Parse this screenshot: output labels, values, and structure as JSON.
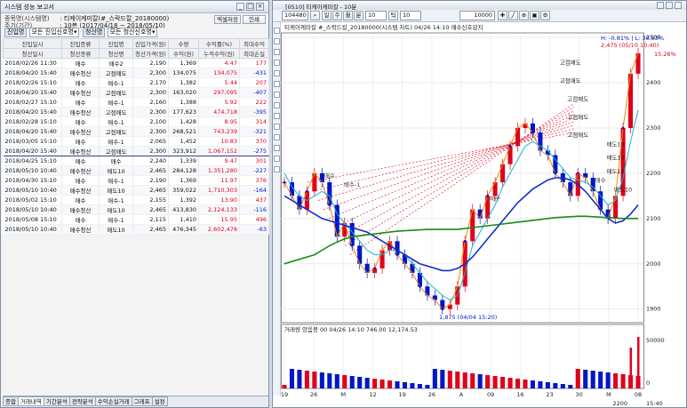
{
  "report": {
    "title": "시스템 성능 보고서",
    "strategy_label": "종목명(시스템명)",
    "strategy_value": ": 티케이케미칼(#_스락드칼_20180000)",
    "period_label": "주기(기간)",
    "period_value": ": 10분 (2017/04/18 ~ 2018/05/10)",
    "buttons": [
      "엑셀저장",
      "인쇄"
    ],
    "filter1_label": "진입명",
    "filter1_value": "모든 진입신호명",
    "filter2_label": "청산명",
    "filter2_value": "모든 청산신호명",
    "headers_top": [
      "진입일시",
      "진입종류",
      "진입명",
      "진입가격(원)",
      "수량",
      "수익률(%)",
      "최대수익"
    ],
    "headers_bottom": [
      "청산일시",
      "청산종류",
      "청산명",
      "청산가격(원)",
      "수익(원)",
      "누적수익(원)",
      "최대손실"
    ],
    "rows": [
      {
        "date": "2018/02/26 11:30",
        "kind": "매수",
        "name": "매수2",
        "price": "2,190",
        "qty": "1,369",
        "pct": "4.47",
        "max": "177",
        "pct_dir": "red",
        "max_dir": "red"
      },
      {
        "date": "2018/04/20 15:40",
        "kind": "매수청산",
        "name": "고점매도",
        "price": "2,300",
        "qty": "134,075",
        "pct": "134,075",
        "max": "-431",
        "pct_dir": "red",
        "max_dir": "blue"
      },
      {
        "date": "2018/02/26 15:10",
        "kind": "매수",
        "name": "매수-1",
        "price": "2,170",
        "qty": "1,382",
        "pct": "5.44",
        "max": "207",
        "pct_dir": "red",
        "max_dir": "red"
      },
      {
        "date": "2018/04/20 15:40",
        "kind": "매수청산",
        "name": "고점매도",
        "price": "2,300",
        "qty": "163,020",
        "pct": "297,095",
        "max": "-407",
        "pct_dir": "red",
        "max_dir": "blue"
      },
      {
        "date": "2018/02/27 15:10",
        "kind": "매수",
        "name": "매수-1",
        "price": "2,160",
        "qty": "1,388",
        "pct": "5.92",
        "max": "222",
        "pct_dir": "red",
        "max_dir": "red"
      },
      {
        "date": "2018/04/20 15:40",
        "kind": "매수청산",
        "name": "고점매도",
        "price": "2,300",
        "qty": "177,623",
        "pct": "474,718",
        "max": "-395",
        "pct_dir": "red",
        "max_dir": "blue"
      },
      {
        "date": "2018/02/28 15:10",
        "kind": "매수",
        "name": "매수-1",
        "price": "2,100",
        "qty": "1,428",
        "pct": "8.95",
        "max": "314",
        "pct_dir": "red",
        "max_dir": "red"
      },
      {
        "date": "2018/04/20 15:40",
        "kind": "매수청산",
        "name": "고점매도",
        "price": "2,300",
        "qty": "268,521",
        "pct": "743,239",
        "max": "-321",
        "pct_dir": "red",
        "max_dir": "blue"
      },
      {
        "date": "2018/03/05 15:10",
        "kind": "매수",
        "name": "매수-1",
        "price": "2,065",
        "qty": "1,452",
        "pct": "10.83",
        "max": "370",
        "pct_dir": "red",
        "max_dir": "red"
      },
      {
        "date": "2018/04/20 15:40",
        "kind": "매수청산",
        "name": "고점매도",
        "price": "2,300",
        "qty": "323,912",
        "pct": "1,067,152",
        "max": "-275",
        "pct_dir": "red",
        "max_dir": "blue"
      },
      {
        "date": "2018/04/25 15:10",
        "kind": "매수",
        "name": "매수",
        "price": "2,240",
        "qty": "1,339",
        "pct": "9.47",
        "max": "301",
        "pct_dir": "red",
        "max_dir": "red"
      },
      {
        "date": "2018/05/10 10:40",
        "kind": "매수청산",
        "name": "매도10",
        "price": "2,465",
        "qty": "284,128",
        "pct": "1,351,280",
        "max": "-227",
        "pct_dir": "red",
        "max_dir": "blue"
      },
      {
        "date": "2018/04/30 15:10",
        "kind": "매수",
        "name": "매수-1",
        "price": "2,190",
        "qty": "1,369",
        "pct": "11.97",
        "max": "376",
        "pct_dir": "red",
        "max_dir": "red"
      },
      {
        "date": "2018/05/10 10:40",
        "kind": "매수청산",
        "name": "매도10",
        "price": "2,465",
        "qty": "359,022",
        "pct": "1,710,303",
        "max": "-164",
        "pct_dir": "red",
        "max_dir": "blue"
      },
      {
        "date": "2018/05/02 15:10",
        "kind": "매수",
        "name": "매수-1",
        "price": "2,155",
        "qty": "1,392",
        "pct": "13.90",
        "max": "437",
        "pct_dir": "red",
        "max_dir": "red"
      },
      {
        "date": "2018/05/10 10:40",
        "kind": "매수청산",
        "name": "매도10",
        "price": "2,465",
        "qty": "413,830",
        "pct": "2,124,133",
        "max": "-116",
        "pct_dir": "red",
        "max_dir": "blue"
      },
      {
        "date": "2018/05/08 15:10",
        "kind": "매수",
        "name": "매수-1",
        "price": "2,115",
        "qty": "1,410",
        "pct": "15.95",
        "max": "496",
        "pct_dir": "red",
        "max_dir": "red"
      },
      {
        "date": "2018/05/10 10:40",
        "kind": "매수청산",
        "name": "매도10",
        "price": "2,465",
        "qty": "476,345",
        "pct": "2,602,478",
        "max": "-63",
        "pct_dir": "red",
        "max_dir": "blue"
      }
    ],
    "tabs": [
      "종합",
      "거래내역",
      "기간분석",
      "전략분석",
      "수익손실거래",
      "그래프",
      "설정"
    ],
    "active_tab": 1
  },
  "chart": {
    "window_title": "[0510] 티케이케미칼 - 10분",
    "code": "104480",
    "interval_value": "10",
    "period_unit": "틱",
    "period_count": "10",
    "price_field": "10000",
    "legend_line": "티케이케미칼 #_스락드칼_20180000(시스템 차트)  04/26 14:10 매수신호감지",
    "hl_label": "H: -0.81% | L: 30.93%",
    "hl_sub": "2,475 (05/10 10:40)",
    "pct_label": "15.26%",
    "low_label": "1,875 (04/04 15:20)",
    "volume_legend": "거래량  양음봉  00  04/26 14:10  746.00  12,174.53",
    "y_ticks": [
      "2500",
      "2400",
      "2300",
      "2200",
      "2100",
      "2000",
      "1900"
    ],
    "vol_ticks": [
      "50000",
      "0"
    ],
    "x_labels": [
      "19",
      "26",
      "M",
      "12",
      "19",
      "26",
      "A",
      "09",
      "16",
      "23",
      "30",
      "M",
      "08"
    ],
    "signal_labels": [
      "고점매도",
      "고점매도",
      "고점매도",
      "고점매도",
      "고점매도",
      "매수",
      "매수",
      "매수",
      "매수-1",
      "매도10",
      "매도10",
      "매도10",
      "매도10"
    ],
    "status_bottom": "2200",
    "time_label": "15:40"
  },
  "chart_data": {
    "type": "line",
    "title": "",
    "xlabel": "",
    "ylabel": "",
    "ylim": [
      1870,
      2510
    ],
    "series": [
      {
        "values": [
          2180,
          2150,
          2120,
          2160,
          2200,
          2180,
          2130,
          2060,
          2090,
          2040,
          2000,
          1980,
          1990,
          2030,
          2050,
          2020,
          2000,
          1980,
          1950,
          1930,
          1920,
          1900,
          1910,
          1950,
          2050,
          2120,
          2100,
          2150,
          2180,
          2220,
          2260,
          2300,
          2310,
          2290,
          2250,
          2240,
          2200,
          2180,
          2150,
          2200,
          2190,
          2160,
          2120,
          2100,
          2150,
          2300,
          2420,
          2465
        ]
      },
      {
        "values": [
          2200,
          2170,
          2150,
          2140,
          2150,
          2160,
          2150,
          2110,
          2090,
          2070,
          2050,
          2030,
          2020,
          2020,
          2030,
          2030,
          2020,
          2000,
          1980,
          1960,
          1945,
          1930,
          1920,
          1930,
          1980,
          2040,
          2070,
          2100,
          2130,
          2170,
          2200,
          2230,
          2260,
          2270,
          2260,
          2250,
          2230,
          2210,
          2190,
          2185,
          2180,
          2170,
          2150,
          2130,
          2140,
          2190,
          2270,
          2340
        ]
      },
      {
        "values": [
          2150,
          2140,
          2130,
          2120,
          2110,
          2100,
          2095,
          2090,
          2085,
          2080,
          2075,
          2070,
          2060,
          2050,
          2040,
          2030,
          2020,
          2010,
          2000,
          1995,
          1990,
          1985,
          1985,
          1990,
          2000,
          2015,
          2035,
          2055,
          2075,
          2095,
          2115,
          2135,
          2150,
          2165,
          2175,
          2185,
          2190,
          2190,
          2185,
          2175,
          2160,
          2140,
          2120,
          2100,
          2090,
          2095,
          2110,
          2130
        ]
      },
      {
        "values": [
          2000,
          2005,
          2010,
          2015,
          2020,
          2030,
          2040,
          2048,
          2055,
          2060,
          2062,
          2064,
          2066,
          2068,
          2070,
          2072,
          2073,
          2074,
          2075,
          2076,
          2076,
          2076,
          2076,
          2076,
          2078,
          2080,
          2082,
          2084,
          2086,
          2088,
          2090,
          2092,
          2094,
          2096,
          2098,
          2100,
          2102,
          2103,
          2104,
          2105,
          2105,
          2104,
          2103,
          2102,
          2101,
          2100,
          2100,
          2100
        ]
      }
    ]
  },
  "colors": {
    "up": "#e0001b",
    "down": "#0016c8",
    "ma_fast": "#f08a00",
    "ma_mid": "#19b4d6",
    "ma_slow": "#1030c8",
    "ma_long": "#1a8a1a"
  }
}
